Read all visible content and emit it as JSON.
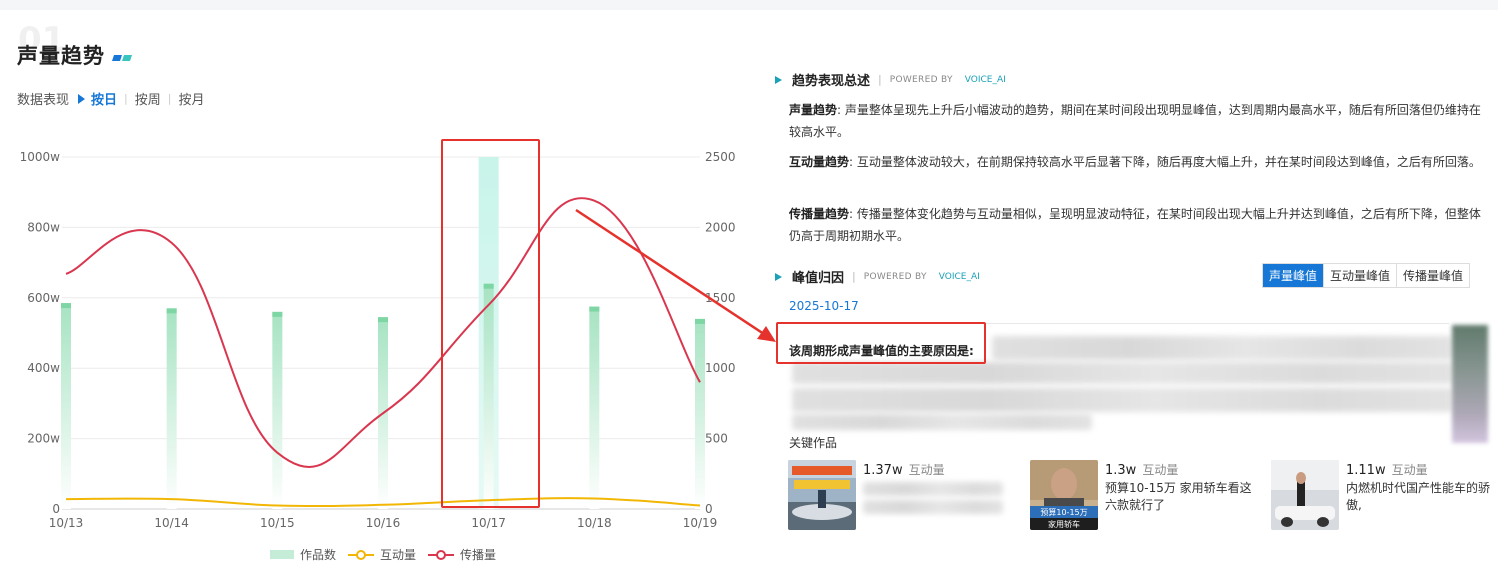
{
  "section_number": "01",
  "page_title": "声量趋势",
  "filter": {
    "label": "数据表现",
    "tabs": [
      {
        "label": "按日",
        "active": true
      },
      {
        "label": "按周",
        "active": false
      },
      {
        "label": "按月",
        "active": false
      }
    ]
  },
  "chart_data": {
    "type": "bar+line",
    "categories": [
      "10/13",
      "10/14",
      "10/15",
      "10/16",
      "10/17",
      "10/18",
      "10/19"
    ],
    "left_axis": {
      "ticks": [
        "0",
        "200w",
        "400w",
        "600w",
        "800w",
        "1000w"
      ],
      "range": [
        0,
        1000
      ]
    },
    "right_axis": {
      "ticks": [
        "0",
        "500",
        "1000",
        "1500",
        "2000",
        "2500"
      ],
      "range": [
        0,
        2500
      ]
    },
    "series": [
      {
        "name": "作品数",
        "kind": "bar",
        "axis": "left",
        "color": "#9ee0bd",
        "values": [
          585,
          570,
          560,
          545,
          640,
          575,
          540
        ],
        "highlight_index": 4,
        "highlight_value": 1000
      },
      {
        "name": "互动量",
        "kind": "line",
        "axis": "left",
        "color": "#f2b705",
        "values": [
          28,
          28,
          10,
          12,
          25,
          30,
          10
        ]
      },
      {
        "name": "传播量",
        "kind": "line",
        "axis": "right",
        "color": "#d9364f",
        "values": [
          1670,
          1890,
          400,
          680,
          1450,
          2190,
          900
        ]
      }
    ],
    "legend_position": "bottom",
    "grid": true
  },
  "summary": {
    "title": "趋势表现总述",
    "powered": "POWERED BY",
    "ai": "VOICE_AI",
    "items": [
      {
        "label": "声量趋势",
        "text": ": 声量整体呈现先上升后小幅波动的趋势，期间在某时间段出现明显峰值，达到周期内最高水平，随后有所回落但仍维持在较高水平。"
      },
      {
        "label": "互动量趋势",
        "text": ": 互动量整体波动较大，在前期保持较高水平后显著下降，随后再度大幅上升，并在某时间段达到峰值，之后有所回落。"
      },
      {
        "label": "传播量趋势",
        "text": ": 传播量整体变化趋势与互动量相似，呈现明显波动特征，在某时间段出现大幅上升并达到峰值，之后有所下降，但整体仍高于周期初期水平。"
      }
    ]
  },
  "peak": {
    "title": "峰值归因",
    "powered": "POWERED BY",
    "ai": "VOICE_AI",
    "tabs": [
      {
        "label": "声量峰值",
        "active": true
      },
      {
        "label": "互动量峰值",
        "active": false
      },
      {
        "label": "传播量峰值",
        "active": false
      }
    ],
    "date": "2025-10-17",
    "reason_label": "该周期形成声量峰值的主要原因是:"
  },
  "key_works": {
    "title": "关键作品",
    "items": [
      {
        "count": "1.37w",
        "metric": "互动量",
        "desc": ""
      },
      {
        "count": "1.3w",
        "metric": "互动量",
        "desc": "预算10-15万 家用轿车看这六款就行了"
      },
      {
        "count": "1.11w",
        "metric": "互动量",
        "desc": "内燃机时代国产性能车的骄傲,"
      }
    ]
  },
  "thumb_texts": {
    "w2_top": "预算10-15万",
    "w2_bottom": "家用轿车"
  },
  "colors": {
    "accent": "#1677d6",
    "teal": "#1aa2b7",
    "annotation": "#e5322d"
  }
}
